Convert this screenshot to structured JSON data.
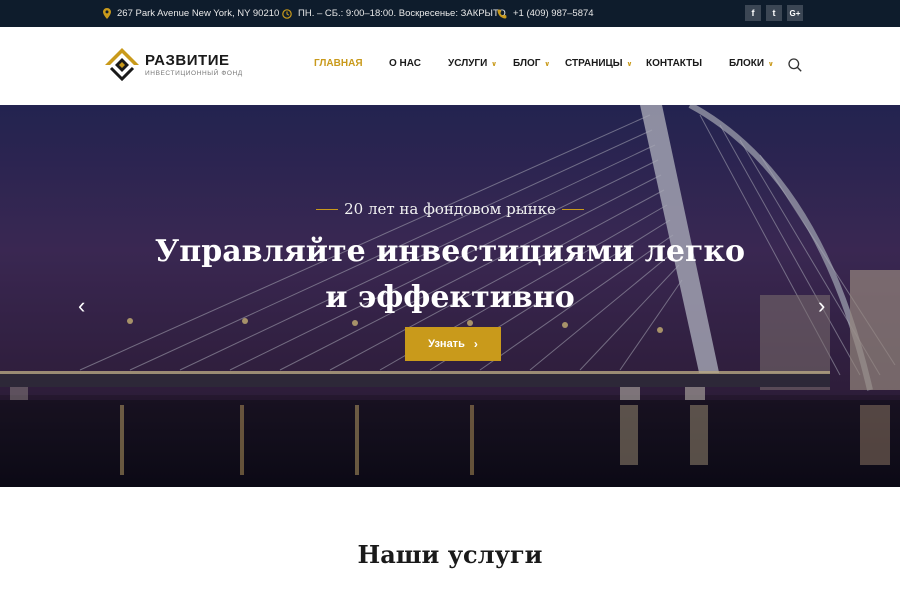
{
  "topbar": {
    "address": "267 Park Avenue New York, NY 90210",
    "hours": "ПН. – СБ.: 9:00–18:00. Воскресенье: ЗАКРЫТО",
    "phone": "+1 (409) 987–5874",
    "social": [
      "f",
      "t",
      "G+"
    ],
    "icon_color": "#c99a1b"
  },
  "header": {
    "logo_title": "РАЗВИТИЕ",
    "logo_subtitle": "ИНВЕСТИЦИОННЫЙ ФОНД",
    "nav": [
      {
        "label": "ГЛАВНАЯ",
        "active": true
      },
      {
        "label": "О НАС"
      },
      {
        "label": "УСЛУГИ",
        "dropdown": true
      },
      {
        "label": "БЛОГ",
        "dropdown": true
      },
      {
        "label": "СТРАНИЦЫ",
        "dropdown": true
      },
      {
        "label": "КОНТАКТЫ"
      },
      {
        "label": "БЛОКИ",
        "dropdown": true
      }
    ],
    "icons": [
      "search-icon"
    ]
  },
  "hero": {
    "eyebrow": "20 лет на фондовом рынке",
    "headline_line1": "Управляйте инвестициями легко",
    "headline_line2": "и эффективно",
    "cta_label": "Узнать",
    "prev_glyph": "‹",
    "next_glyph": "›"
  },
  "services": {
    "title": "Наши услуги"
  },
  "colors": {
    "accent": "#c99a1b",
    "topbar_bg": "#0e1c2c",
    "text_dark": "#1a1a1a"
  }
}
